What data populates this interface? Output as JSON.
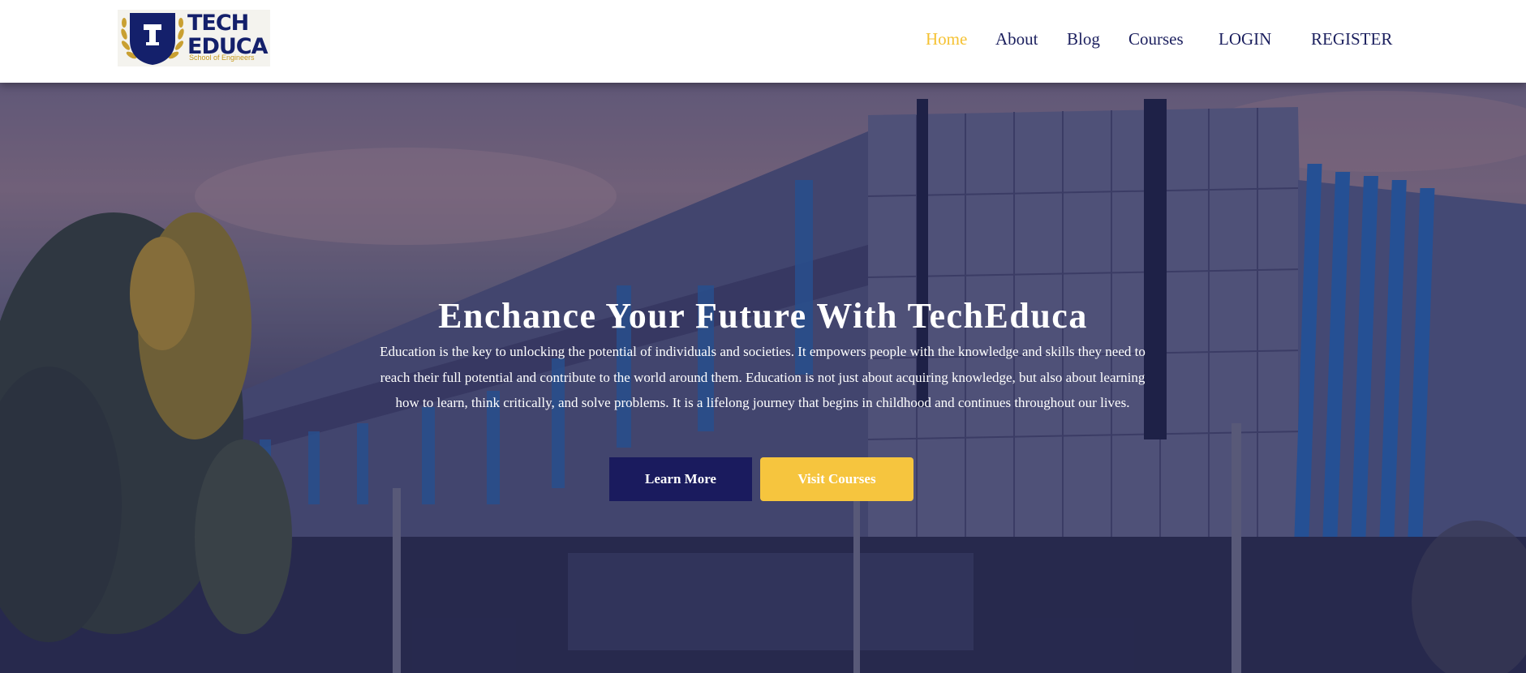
{
  "logo": {
    "line1": "TECH",
    "line2": "EDUCA",
    "tagline": "School of Engineers",
    "shield_letter": "T"
  },
  "nav": {
    "items": [
      {
        "label": "Home",
        "active": true
      },
      {
        "label": "About",
        "active": false
      },
      {
        "label": "Blog",
        "active": false
      },
      {
        "label": "Courses",
        "active": false
      },
      {
        "label": "LOGIN",
        "active": false
      },
      {
        "label": "REGISTER",
        "active": false
      }
    ]
  },
  "hero": {
    "title": "Enchance Your Future With TechEduca",
    "description": "Education is the key to unlocking the potential of individuals and societies. It empowers people with the knowledge and skills they need to reach their full potential and contribute to the world around them. Education is not just about acquiring knowledge, but also about learning how to learn, think critically, and solve problems. It is a lifelong journey that begins in childhood and continues throughout our lives.",
    "primary_button": "Learn More",
    "secondary_button": "Visit Courses"
  },
  "colors": {
    "brand_navy": "#1a1b5e",
    "accent_yellow": "#f6c53e",
    "nav_active": "#f5c233"
  },
  "icons": {
    "logo_shield": "shield-icon",
    "logo_laurel": "laurel-icon"
  }
}
